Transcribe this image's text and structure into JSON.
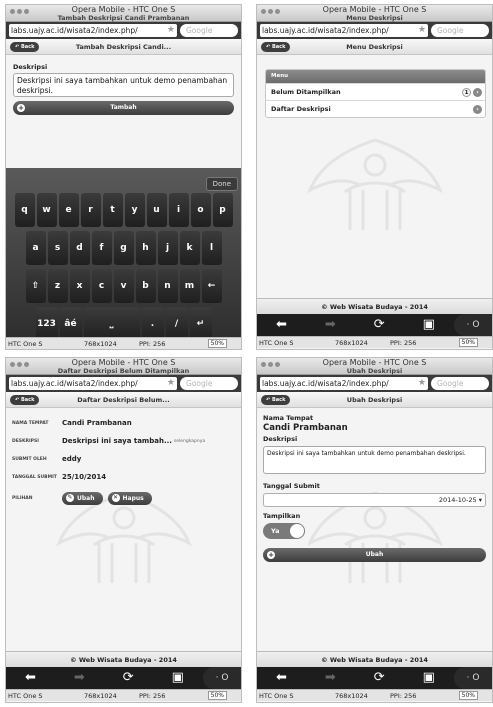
{
  "browser": {
    "window_title": "Opera Mobile - HTC One S",
    "url": "labs.uajy.ac.id/wisata2/index.php/",
    "search_placeholder": "Google",
    "device": "HTC One S",
    "resolution": "768x1024",
    "ppi": "PPI: 256",
    "zoom": "50%",
    "nav": {
      "back": "⬅",
      "forward": "➡",
      "reload": "⟳",
      "tabs": "▣",
      "opera": "· O"
    }
  },
  "common": {
    "back_label": "Back",
    "footer": "© Web Wisata Budaya - 2014"
  },
  "screen1": {
    "page_title": "Tambah Deskripsi Candi Prambanan",
    "header": "Tambah Deskripsi Candi...",
    "field_label": "Deskripsi",
    "field_value": "Deskripsi ini saya tambahkan untuk demo penambahan deskripsi.",
    "button": "Tambah",
    "keyboard": {
      "done": "Done",
      "row1": [
        "q",
        "w",
        "e",
        "r",
        "t",
        "y",
        "u",
        "i",
        "o",
        "p"
      ],
      "row2": [
        "a",
        "s",
        "d",
        "f",
        "g",
        "h",
        "j",
        "k",
        "l"
      ],
      "row3": [
        "⇧",
        "z",
        "x",
        "c",
        "v",
        "b",
        "n",
        "m",
        "←"
      ],
      "row4": [
        "123",
        "âé",
        "⎵",
        ".",
        "/",
        "↵"
      ]
    }
  },
  "screen2": {
    "page_title": "Menu Deskripsi",
    "header": "Menu Deskripsi",
    "list_header": "Menu",
    "items": [
      {
        "label": "Belum Ditampilkan",
        "count": "1"
      },
      {
        "label": "Daftar Deskripsi",
        "count": ""
      }
    ]
  },
  "screen3": {
    "page_title": "Daftar Deskripsi Belum Ditampilkan",
    "header": "Daftar Deskripsi Belum...",
    "rows": [
      {
        "key": "NAMA TEMPAT",
        "value": "Candi Prambanan",
        "extra": ""
      },
      {
        "key": "DESKRIPSI",
        "value": "Deskripsi ini saya tambah...",
        "extra": "selengkapnya"
      },
      {
        "key": "SUBMIT OLEH",
        "value": "eddy",
        "extra": ""
      },
      {
        "key": "TANGGAL SUBMIT",
        "value": "25/10/2014",
        "extra": ""
      }
    ],
    "options_key": "PILIHAN",
    "edit_button": "Ubah",
    "delete_button": "Hapus"
  },
  "screen4": {
    "page_title": "Ubah Deskripsi",
    "header": "Ubah Deskripsi",
    "place_label": "Nama Tempat",
    "place_value": "Candi Prambanan",
    "desc_label": "Deskripsi",
    "desc_value": "Deskripsi ini saya tambahkan untuk demo penambahan deskripsi.",
    "date_label": "Tanggal Submit",
    "date_value": "2014-10-25",
    "show_label": "Tampilkan",
    "toggle_value": "Ya",
    "button": "Ubah"
  }
}
